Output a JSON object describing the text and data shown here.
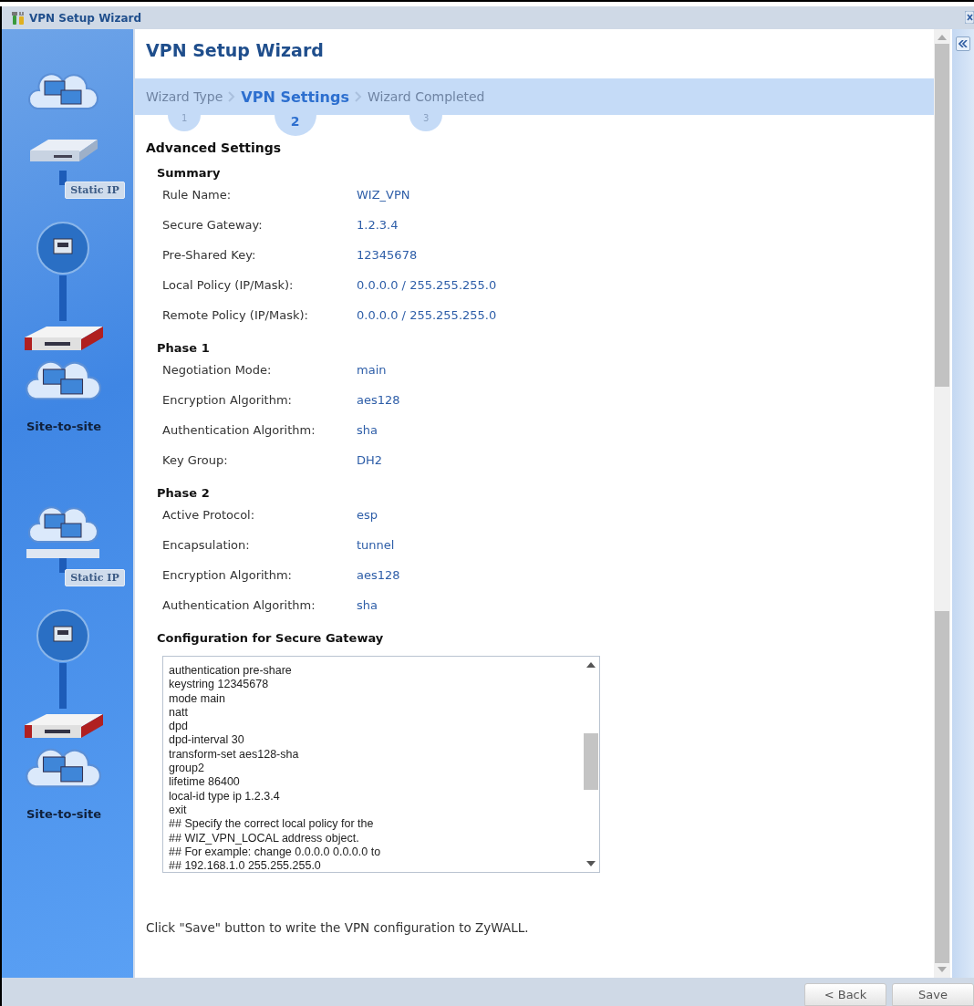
{
  "window": {
    "title": "VPN Setup Wizard"
  },
  "sidebar": {
    "panels": [
      {
        "tag": "Static IP",
        "caption": "Site-to-site",
        "cropped": false
      },
      {
        "tag": "Static IP",
        "caption": "Site-to-site",
        "cropped": true
      }
    ]
  },
  "heading": "VPN Setup Wizard",
  "steps": [
    {
      "label": "Wizard Type",
      "number": "1",
      "selected": false
    },
    {
      "label": "VPN Settings",
      "number": "2",
      "selected": true
    },
    {
      "label": "Wizard Completed",
      "number": "3",
      "selected": false
    }
  ],
  "section_title": "Advanced Settings",
  "groups": [
    {
      "title": "Summary",
      "rows": [
        {
          "label": "Rule Name:",
          "value": "WIZ_VPN"
        },
        {
          "label": "Secure Gateway:",
          "value": "1.2.3.4"
        },
        {
          "label": "Pre-Shared Key:",
          "value": "12345678"
        },
        {
          "label": "Local Policy (IP/Mask):",
          "value": "0.0.0.0 / 255.255.255.0"
        },
        {
          "label": "Remote Policy (IP/Mask):",
          "value": "0.0.0.0 / 255.255.255.0"
        }
      ]
    },
    {
      "title": "Phase 1",
      "rows": [
        {
          "label": "Negotiation Mode:",
          "value": "main"
        },
        {
          "label": "Encryption Algorithm:",
          "value": "aes128"
        },
        {
          "label": "Authentication Algorithm:",
          "value": "sha"
        },
        {
          "label": "Key Group:",
          "value": "DH2"
        }
      ]
    },
    {
      "title": "Phase 2",
      "rows": [
        {
          "label": "Active Protocol:",
          "value": "esp"
        },
        {
          "label": "Encapsulation:",
          "value": "tunnel"
        },
        {
          "label": "Encryption Algorithm:",
          "value": "aes128"
        },
        {
          "label": "Authentication Algorithm:",
          "value": "sha"
        }
      ]
    }
  ],
  "config": {
    "title": "Configuration for Secure Gateway",
    "lines": [
      "authentication pre-share",
      "keystring 12345678",
      "mode main",
      "natt",
      "dpd",
      "dpd-interval 30",
      "transform-set aes128-sha",
      "group2",
      "lifetime 86400",
      "local-id type ip 1.2.3.4",
      "exit",
      "## Specify the correct local policy for the",
      "## WIZ_VPN_LOCAL address object.",
      "## For example: change 0.0.0.0 0.0.0.0 to",
      "## 192.168.1.0 255.255.255.0"
    ]
  },
  "note": "Click \"Save\" button to write the VPN configuration to ZyWALL.",
  "buttons": [
    "< Back",
    "Save"
  ]
}
